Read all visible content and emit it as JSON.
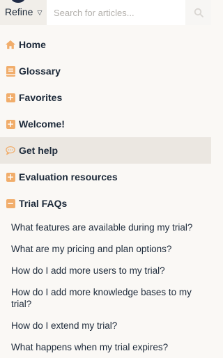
{
  "header": {
    "refine_label": "Refine",
    "search_placeholder": "Search for articles..."
  },
  "nav": [
    {
      "label": "Home",
      "icon": "home-icon"
    },
    {
      "label": "Glossary",
      "icon": "book-icon"
    },
    {
      "label": "Favorites",
      "icon": "plus-box-icon"
    },
    {
      "label": "Welcome!",
      "icon": "plus-box-icon"
    },
    {
      "label": "Get help",
      "icon": "chat-bubble-icon",
      "active": true
    },
    {
      "label": "Evaluation resources",
      "icon": "plus-box-icon"
    },
    {
      "label": "Trial FAQs",
      "icon": "minus-box-icon",
      "expanded": true
    }
  ],
  "trial_faqs": [
    "What features are available during my trial?",
    "What are my pricing and plan options?",
    "How do I add more users to my trial?",
    "How do I add more knowledge bases to my trial?",
    "How do I extend my trial?",
    "What happens when my trial expires?"
  ],
  "colors": {
    "accent": "#f1ad6b",
    "text": "#1d2a3a",
    "active_bg": "#ebe7e1",
    "background": "#faf8f5"
  }
}
